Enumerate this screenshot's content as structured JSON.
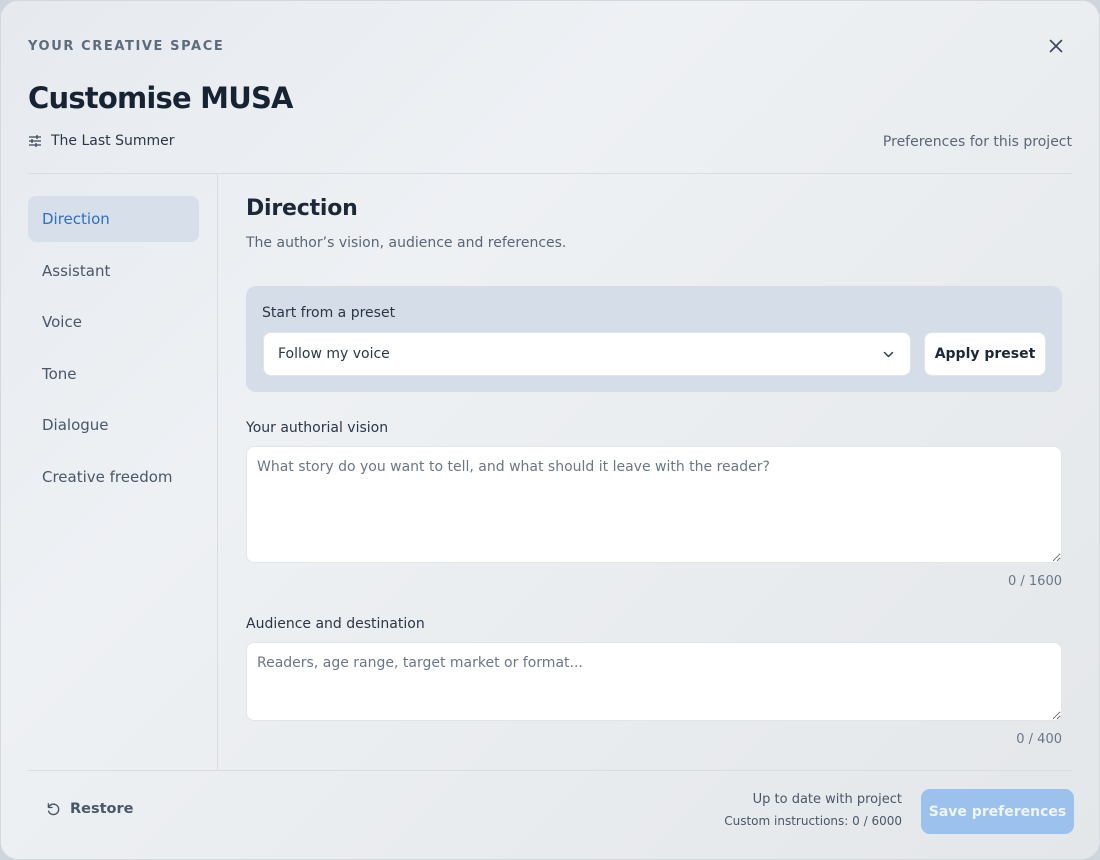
{
  "header": {
    "eyebrow": "YOUR CREATIVE SPACE",
    "title": "Customise MUSA",
    "project_name": "The Last Summer",
    "scope_label": "Preferences for this project",
    "close_icon": "close-icon",
    "project_icon": "sliders-icon"
  },
  "sidebar": {
    "items": [
      {
        "label": "Direction",
        "active": true
      },
      {
        "label": "Assistant",
        "active": false
      },
      {
        "label": "Voice",
        "active": false
      },
      {
        "label": "Tone",
        "active": false
      },
      {
        "label": "Dialogue",
        "active": false
      },
      {
        "label": "Creative freedom",
        "active": false
      }
    ]
  },
  "main": {
    "title": "Direction",
    "subtitle": "The author’s vision, audience and references.",
    "preset": {
      "label": "Start from a preset",
      "selected": "Follow my voice",
      "apply_label": "Apply preset"
    },
    "vision": {
      "label": "Your authorial vision",
      "value": "",
      "placeholder": "What story do you want to tell, and what should it leave with the reader?",
      "counter": "0 / 1600"
    },
    "audience": {
      "label": "Audience and destination",
      "value": "",
      "placeholder": "Readers, age range, target market or format...",
      "counter": "0 / 400"
    }
  },
  "footer": {
    "restore_label": "Restore",
    "restore_icon": "restore-icon",
    "status_line1": "Up to date with project",
    "status_line2": "Custom instructions: 0 / 6000",
    "save_label": "Save preferences"
  },
  "colors": {
    "accent": "#2f6fc4",
    "active_nav_bg": "#d6dfea",
    "preset_bg": "#d5dde8",
    "save_button_disabled": "#9cc1ec"
  }
}
